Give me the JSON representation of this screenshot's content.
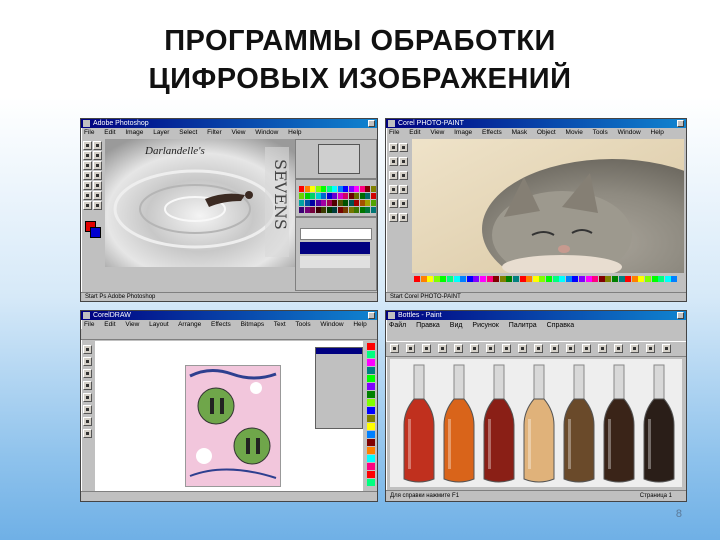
{
  "slide": {
    "title_line1": "ПРОГРАММЫ ОБРАБОТКИ",
    "title_line2": "ЦИФРОВЫХ ИЗОБРАЖЕНИЙ",
    "page_number": "8"
  },
  "window_photoshop": {
    "title": "Adobe Photoshop",
    "menu": [
      "File",
      "Edit",
      "Image",
      "Layer",
      "Select",
      "Filter",
      "View",
      "Window",
      "Help"
    ],
    "doc_title": "Darlandelle's",
    "status": "Start  Ps  Adobe Photoshop"
  },
  "window_corel_photopaint": {
    "title": "Corel PHOTO-PAINT",
    "menu": [
      "File",
      "Edit",
      "View",
      "Image",
      "Effects",
      "Mask",
      "Object",
      "Movie",
      "Tools",
      "Window",
      "Help"
    ],
    "status": "Start  Corel PHOTO-PAINT"
  },
  "window_coreldraw": {
    "title": "CorelDRAW",
    "menu": [
      "File",
      "Edit",
      "View",
      "Layout",
      "Arrange",
      "Effects",
      "Bitmaps",
      "Text",
      "Tools",
      "Window",
      "Help"
    ]
  },
  "window_editor": {
    "title": "Bottles - Paint",
    "menu": [
      "Файл",
      "Правка",
      "Вид",
      "Рисунок",
      "Палитра",
      "Справка"
    ],
    "status_left": "Для справки нажмите F1",
    "status_right": "Страница 1"
  },
  "colors": {
    "titlebar": "#000080",
    "window_face": "#c0c0c0"
  }
}
